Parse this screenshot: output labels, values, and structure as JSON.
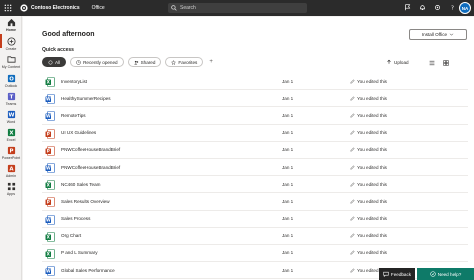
{
  "topbar": {
    "org_name": "Contoso Electronics",
    "app_name": "Office",
    "search_placeholder": "Search",
    "avatar_initials": "NA"
  },
  "rail": {
    "items": [
      {
        "label": "Home",
        "icon": "home-icon"
      },
      {
        "label": "Create",
        "icon": "create-icon"
      },
      {
        "label": "My Content",
        "icon": "my-content-icon"
      },
      {
        "label": "Outlook",
        "icon": "outlook-icon"
      },
      {
        "label": "Teams",
        "icon": "teams-icon"
      },
      {
        "label": "Word",
        "icon": "word-icon"
      },
      {
        "label": "Excel",
        "icon": "excel-icon"
      },
      {
        "label": "PowerPoint",
        "icon": "powerpoint-icon"
      },
      {
        "label": "Admin",
        "icon": "admin-icon"
      },
      {
        "label": "Apps",
        "icon": "apps-icon"
      }
    ]
  },
  "main": {
    "greeting": "Good afternoon",
    "install_label": "Install Office",
    "quick_access_label": "Quick access",
    "filters": [
      "All",
      "Recently opened",
      "Shared",
      "Favorites"
    ],
    "upload_label": "Upload"
  },
  "files": [
    {
      "name": "InventoryList",
      "type": "excel",
      "date": "Jan 1",
      "activity": "You edited this"
    },
    {
      "name": "HealthySummerRecipes",
      "type": "word",
      "date": "Jan 1",
      "activity": "You edited this"
    },
    {
      "name": "RemoteTips",
      "type": "word",
      "date": "Jan 1",
      "activity": "You edited this"
    },
    {
      "name": "UI UX Guidelines",
      "type": "powerpoint",
      "date": "Jan 1",
      "activity": "You edited this"
    },
    {
      "name": "PNWCoffeeHouseBrandBrief",
      "type": "powerpoint",
      "date": "Jan 1",
      "activity": "You edited this"
    },
    {
      "name": "PNWCoffeeHouseBrandBrief",
      "type": "word",
      "date": "Jan 1",
      "activity": "You edited this"
    },
    {
      "name": "NC460 Sales Team",
      "type": "excel",
      "date": "Jan 1",
      "activity": "You edited this"
    },
    {
      "name": "Sales Results Overview",
      "type": "powerpoint",
      "date": "Jan 1",
      "activity": "You edited this"
    },
    {
      "name": "Sales Process",
      "type": "word",
      "date": "Jan 1",
      "activity": "You edited this"
    },
    {
      "name": "Org Chart",
      "type": "excel",
      "date": "Jan 1",
      "activity": "You edited this"
    },
    {
      "name": "P and L Summary",
      "type": "excel",
      "date": "Jan 1",
      "activity": "You edited this"
    },
    {
      "name": "Global Sales Performance",
      "type": "word",
      "date": "Jan 1",
      "activity": "You edited this"
    }
  ],
  "footer": {
    "feedback_label": "Feedback",
    "help_label": "Need help?"
  },
  "colors": {
    "topbar": "#2b2b2b",
    "accent": "#c43e1c",
    "word": "#185abd",
    "excel": "#107c41",
    "powerpoint": "#c43e1c",
    "help": "#0e7a68"
  }
}
